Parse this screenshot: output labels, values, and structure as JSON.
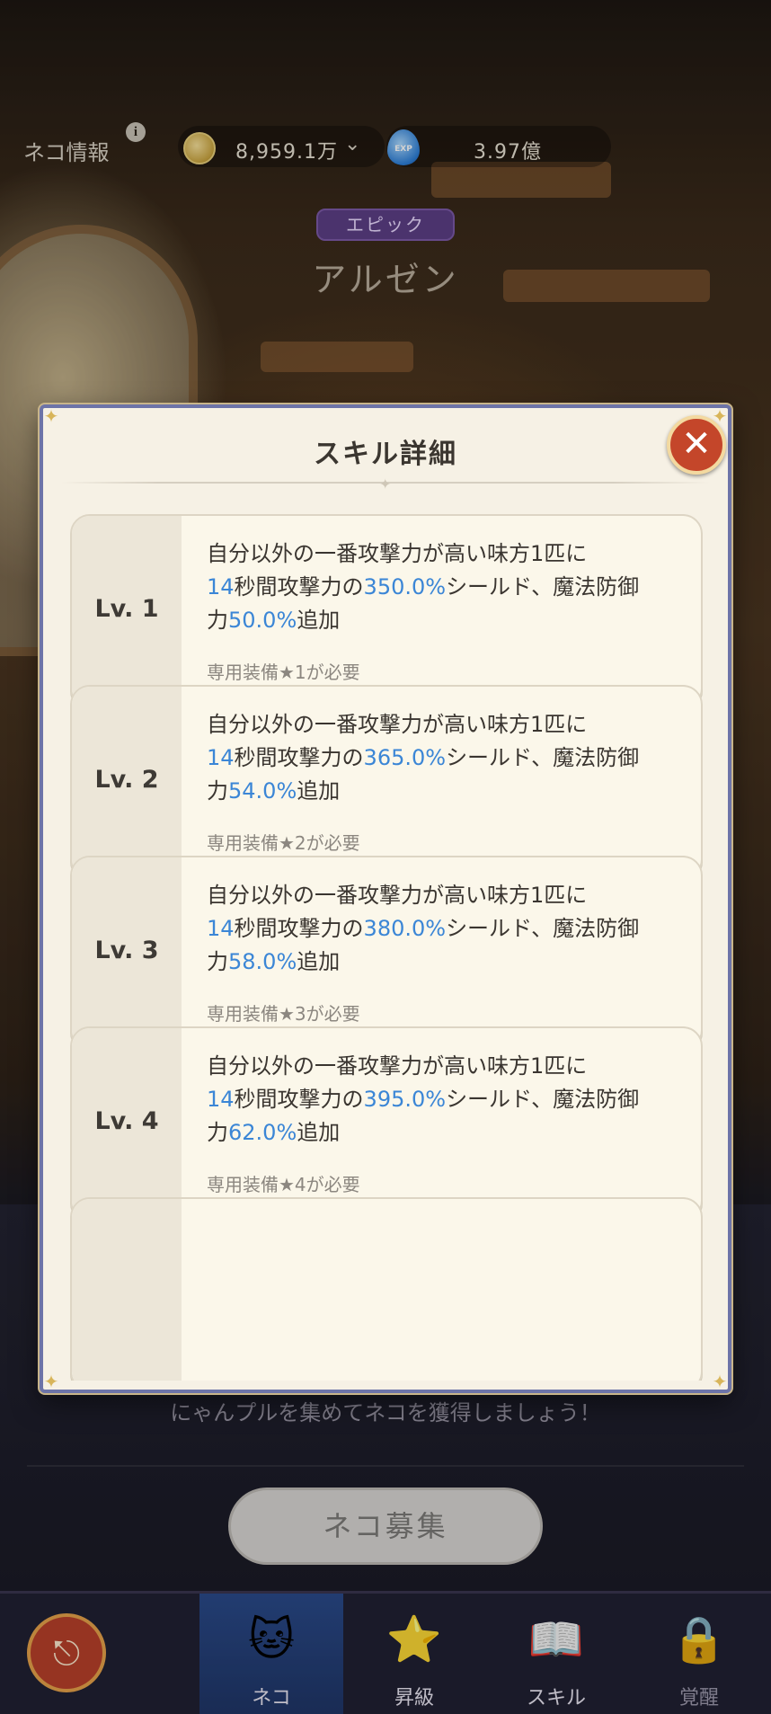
{
  "topbar": {
    "info_label": "ネコ情報",
    "info_icon": "i",
    "coin_value": "8,959.1万",
    "coin_chevron": "⌄",
    "exp_icon_text": "EXP",
    "exp_value": "3.97億"
  },
  "character": {
    "rarity": "エピック",
    "name": "アルゼン"
  },
  "modal": {
    "title": "スキル詳細",
    "close_symbol": "✕",
    "skills": [
      {
        "level": "Lv. 1",
        "line1": "自分以外の一番攻撃力が高い味方1匹に",
        "duration": "14",
        "part_a": "秒間攻撃力の",
        "shield": "350.0%",
        "part_b": "シールド、魔法防御",
        "part_c": "力",
        "mdef": "50.0%",
        "part_d": "追加",
        "requirement": "専用装備★1が必要"
      },
      {
        "level": "Lv. 2",
        "line1": "自分以外の一番攻撃力が高い味方1匹に",
        "duration": "14",
        "part_a": "秒間攻撃力の",
        "shield": "365.0%",
        "part_b": "シールド、魔法防御",
        "part_c": "力",
        "mdef": "54.0%",
        "part_d": "追加",
        "requirement": "専用装備★2が必要"
      },
      {
        "level": "Lv. 3",
        "line1": "自分以外の一番攻撃力が高い味方1匹に",
        "duration": "14",
        "part_a": "秒間攻撃力の",
        "shield": "380.0%",
        "part_b": "シールド、魔法防御",
        "part_c": "力",
        "mdef": "58.0%",
        "part_d": "追加",
        "requirement": "専用装備★3が必要"
      },
      {
        "level": "Lv. 4",
        "line1": "自分以外の一番攻撃力が高い味方1匹に",
        "duration": "14",
        "part_a": "秒間攻撃力の",
        "shield": "395.0%",
        "part_b": "シールド、魔法防御",
        "part_c": "力",
        "mdef": "62.0%",
        "part_d": "追加",
        "requirement": "専用装備★4が必要"
      }
    ]
  },
  "behind_text": "にゃんプルを集めてネコを獲得しましょう！",
  "recruit_button": "ネコ募集",
  "nav": {
    "back_symbol": "⎋",
    "tabs": [
      {
        "label": "ネコ",
        "icon": "cat-icon",
        "glyph": "🐱",
        "active": true
      },
      {
        "label": "昇級",
        "icon": "star-upgrade-icon",
        "glyph": "⭐",
        "active": false
      },
      {
        "label": "スキル",
        "icon": "skill-book-icon",
        "glyph": "📖",
        "active": false
      },
      {
        "label": "覚醒",
        "icon": "lock-icon",
        "glyph": "🔒",
        "active": false
      }
    ]
  },
  "colors": {
    "highlight_blue": "#3b86d6",
    "rarity_purple": "#5c3f86",
    "close_red": "#c4462a",
    "modal_border": "#6d74a8"
  }
}
